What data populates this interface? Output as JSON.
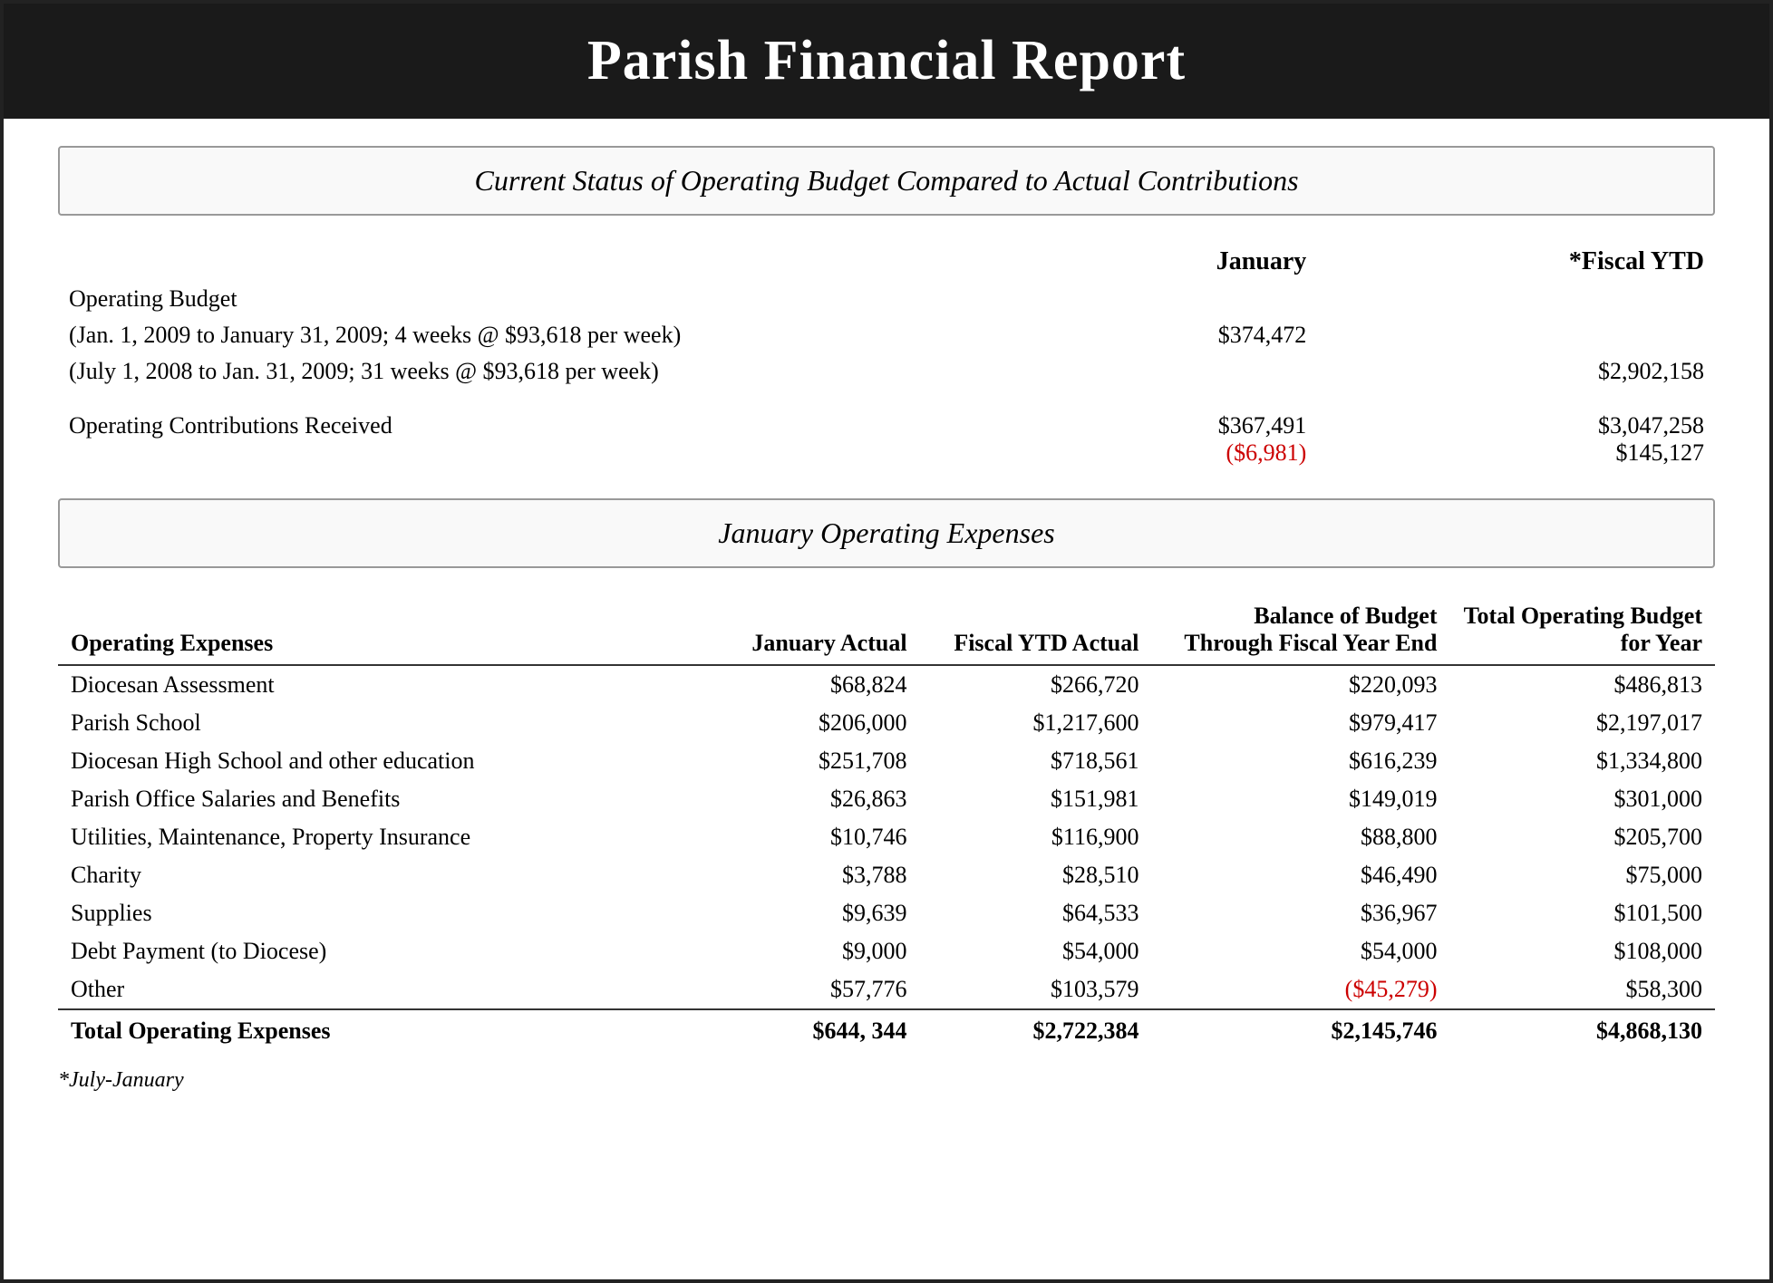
{
  "header": {
    "title": "Parish Financial Report"
  },
  "section1": {
    "title": "Current Status of Operating Budget Compared to Actual Contributions"
  },
  "budget": {
    "col_jan_header": "January",
    "col_ytd_header": "*Fiscal YTD",
    "operating_budget_label": "Operating Budget",
    "jan_detail": "(Jan. 1, 2009 to January 31, 2009; 4 weeks @ $93,618 per week)",
    "ytd_detail": "(July 1, 2008 to Jan. 31, 2009; 31 weeks @ $93,618 per week)",
    "jan_amount": "$374,472",
    "ytd_amount": "$2,902,158",
    "contributions_label": "Operating Contributions Received",
    "contrib_jan": "$367,491",
    "contrib_jan_diff": "($6,981)",
    "contrib_ytd": "$3,047,258",
    "contrib_ytd_diff": "$145,127"
  },
  "section2": {
    "title": "January Operating Expenses"
  },
  "expenses": {
    "col_desc": "Operating Expenses",
    "col_jan_actual": "January Actual",
    "col_ytd_actual": "Fiscal YTD Actual",
    "col_balance": "Balance of Budget Through Fiscal Year End",
    "col_total": "Total Operating Budget for Year",
    "rows": [
      {
        "label": "Diocesan Assessment",
        "jan": "$68,824",
        "ytd": "$266,720",
        "balance": "$220,093",
        "total": "$486,813",
        "balance_red": false
      },
      {
        "label": "Parish School",
        "jan": "$206,000",
        "ytd": "$1,217,600",
        "balance": "$979,417",
        "total": "$2,197,017",
        "balance_red": false
      },
      {
        "label": "Diocesan High School and other education",
        "jan": "$251,708",
        "ytd": "$718,561",
        "balance": "$616,239",
        "total": "$1,334,800",
        "balance_red": false
      },
      {
        "label": "Parish Office Salaries and Benefits",
        "jan": "$26,863",
        "ytd": "$151,981",
        "balance": "$149,019",
        "total": "$301,000",
        "balance_red": false
      },
      {
        "label": "Utilities, Maintenance, Property Insurance",
        "jan": "$10,746",
        "ytd": "$116,900",
        "balance": "$88,800",
        "total": "$205,700",
        "balance_red": false
      },
      {
        "label": "Charity",
        "jan": "$3,788",
        "ytd": "$28,510",
        "balance": "$46,490",
        "total": "$75,000",
        "balance_red": false
      },
      {
        "label": "Supplies",
        "jan": "$9,639",
        "ytd": "$64,533",
        "balance": "$36,967",
        "total": "$101,500",
        "balance_red": false
      },
      {
        "label": "Debt Payment (to Diocese)",
        "jan": "$9,000",
        "ytd": "$54,000",
        "balance": "$54,000",
        "total": "$108,000",
        "balance_red": false
      },
      {
        "label": "Other",
        "jan": "$57,776",
        "ytd": "$103,579",
        "balance": "($45,279)",
        "total": "$58,300",
        "balance_red": true
      }
    ],
    "total_row": {
      "label": "Total Operating Expenses",
      "jan": "$644, 344",
      "ytd": "$2,722,384",
      "balance": "$2,145,746",
      "total": "$4,868,130"
    }
  },
  "footnote": "*July-January"
}
